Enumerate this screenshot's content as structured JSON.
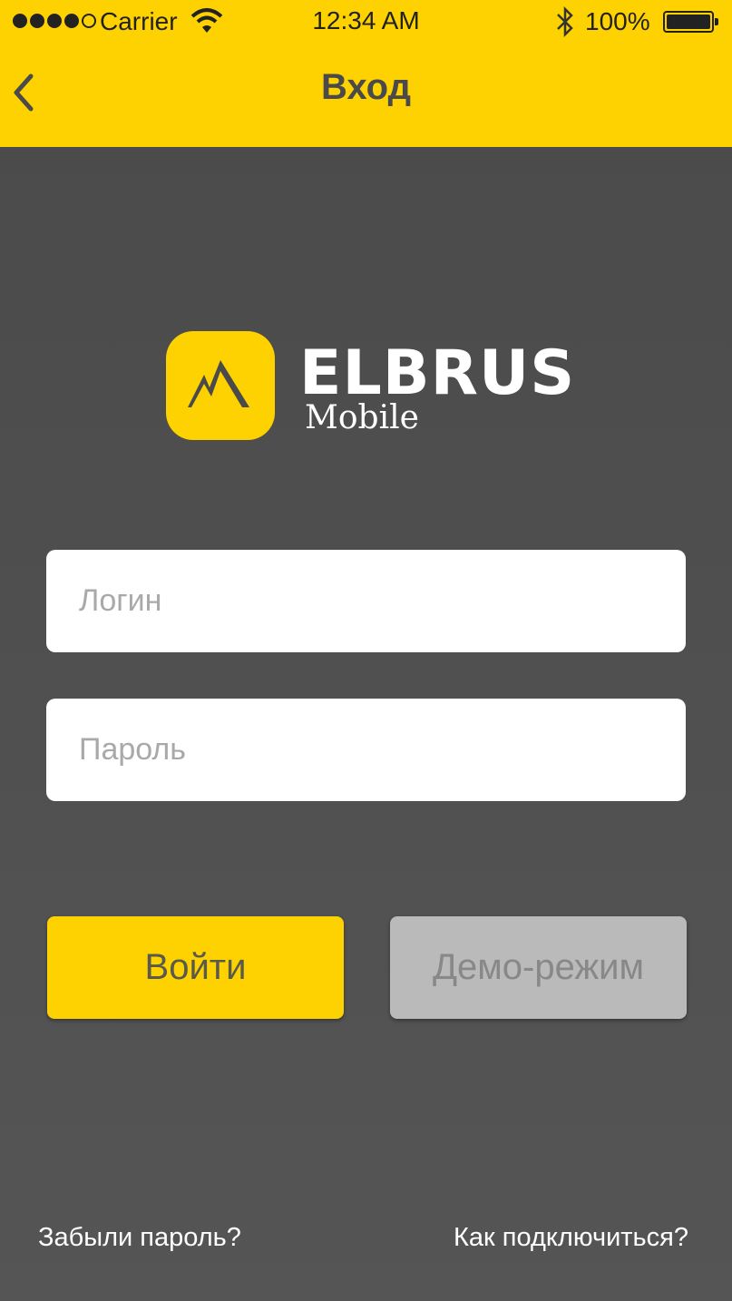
{
  "status_bar": {
    "carrier": "Carrier",
    "time": "12:34 AM",
    "battery": "100%"
  },
  "nav": {
    "title": "Вход"
  },
  "logo": {
    "title": "ELBRUS",
    "subtitle": "Mobile"
  },
  "form": {
    "login_placeholder": "Логин",
    "password_placeholder": "Пароль"
  },
  "buttons": {
    "login": "Войти",
    "demo": "Демо-режим"
  },
  "links": {
    "forgot": "Забыли пароль?",
    "connect": "Как подключиться?"
  },
  "colors": {
    "accent": "#fed200",
    "background": "#4d4d4d",
    "demo_button": "#bababa"
  }
}
